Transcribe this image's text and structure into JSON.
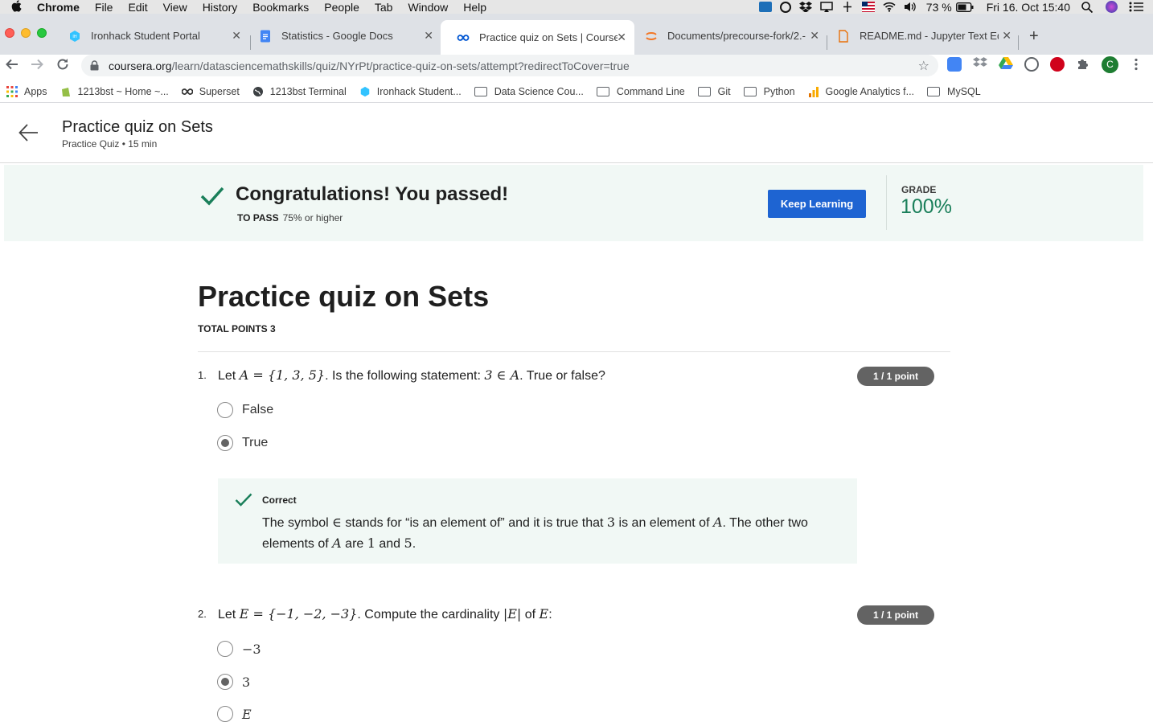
{
  "os_menubar": {
    "app": "Chrome",
    "items": [
      "File",
      "Edit",
      "View",
      "History",
      "Bookmarks",
      "People",
      "Tab",
      "Window",
      "Help"
    ],
    "battery": "73 %",
    "clock": "Fri 16. Oct  15:40"
  },
  "tabs": [
    {
      "title": "Ironhack Student Portal",
      "active": false
    },
    {
      "title": "Statistics - Google Docs",
      "active": false
    },
    {
      "title": "Practice quiz on Sets | Coursera",
      "active": true
    },
    {
      "title": "Documents/precourse-fork/2.-",
      "active": false
    },
    {
      "title": "README.md - Jupyter Text Editor",
      "active": false
    }
  ],
  "toolbar": {
    "url_host": "coursera.org",
    "url_path": "/learn/datasciencemathskills/quiz/NYrPt/practice-quiz-on-sets/attempt?redirectToCover=true",
    "profile_initial": "C"
  },
  "bookmarks": [
    {
      "label": "Apps",
      "icon": "apps-grid-icon"
    },
    {
      "label": "1213bst ~ Home ~...",
      "icon": "shopify-icon"
    },
    {
      "label": "Superset",
      "icon": "superset-icon"
    },
    {
      "label": "1213bst Terminal",
      "icon": "globe-icon"
    },
    {
      "label": "Ironhack Student...",
      "icon": "ironhack-icon"
    },
    {
      "label": "Data Science Cou...",
      "icon": "folder-icon"
    },
    {
      "label": "Command Line",
      "icon": "folder-icon"
    },
    {
      "label": "Git",
      "icon": "folder-icon"
    },
    {
      "label": "Python",
      "icon": "folder-icon"
    },
    {
      "label": "Google Analytics f...",
      "icon": "analytics-icon"
    },
    {
      "label": "MySQL",
      "icon": "folder-icon"
    }
  ],
  "page_header": {
    "title": "Practice quiz on Sets",
    "subtitle": "Practice Quiz • 15 min"
  },
  "result": {
    "headline": "Congratulations! You passed!",
    "to_pass_label": "TO PASS",
    "to_pass_value": "75% or higher",
    "button_label": "Keep Learning",
    "grade_label": "GRADE",
    "grade_value": "100%"
  },
  "quiz": {
    "title": "Practice quiz on Sets",
    "total_points": "TOTAL POINTS 3",
    "questions": [
      {
        "number": "1.",
        "prompt_parts": [
          "Let ",
          "A = {1, 3, 5}",
          ". Is the following statement: ",
          "3 ∈ A",
          ". True or false?"
        ],
        "points": "1 / 1 point",
        "options": [
          {
            "label": "False",
            "selected": false
          },
          {
            "label": "True",
            "selected": true
          }
        ],
        "feedback": {
          "label": "Correct",
          "text_parts": [
            "The symbol ",
            "∈",
            " stands for “is an element of” and it is true that ",
            "3",
            " is an element of ",
            "A",
            ". The other two elements of ",
            "A",
            " are ",
            "1",
            " and ",
            "5",
            "."
          ]
        }
      },
      {
        "number": "2.",
        "prompt_parts": [
          "Let ",
          "E = {−1, −2, −3}",
          ". Compute the cardinality ",
          "|E|",
          " of ",
          "E",
          ":"
        ],
        "points": "1 / 1 point",
        "options": [
          {
            "label": "−3",
            "selected": false
          },
          {
            "label": "3",
            "selected": true
          },
          {
            "label": "E",
            "selected": false
          }
        ]
      }
    ]
  },
  "colors": {
    "accent_blue": "#1e64d2",
    "success_green": "#1a7f5a",
    "banner_bg": "#f1f8f5",
    "badge_gray": "#636363"
  }
}
